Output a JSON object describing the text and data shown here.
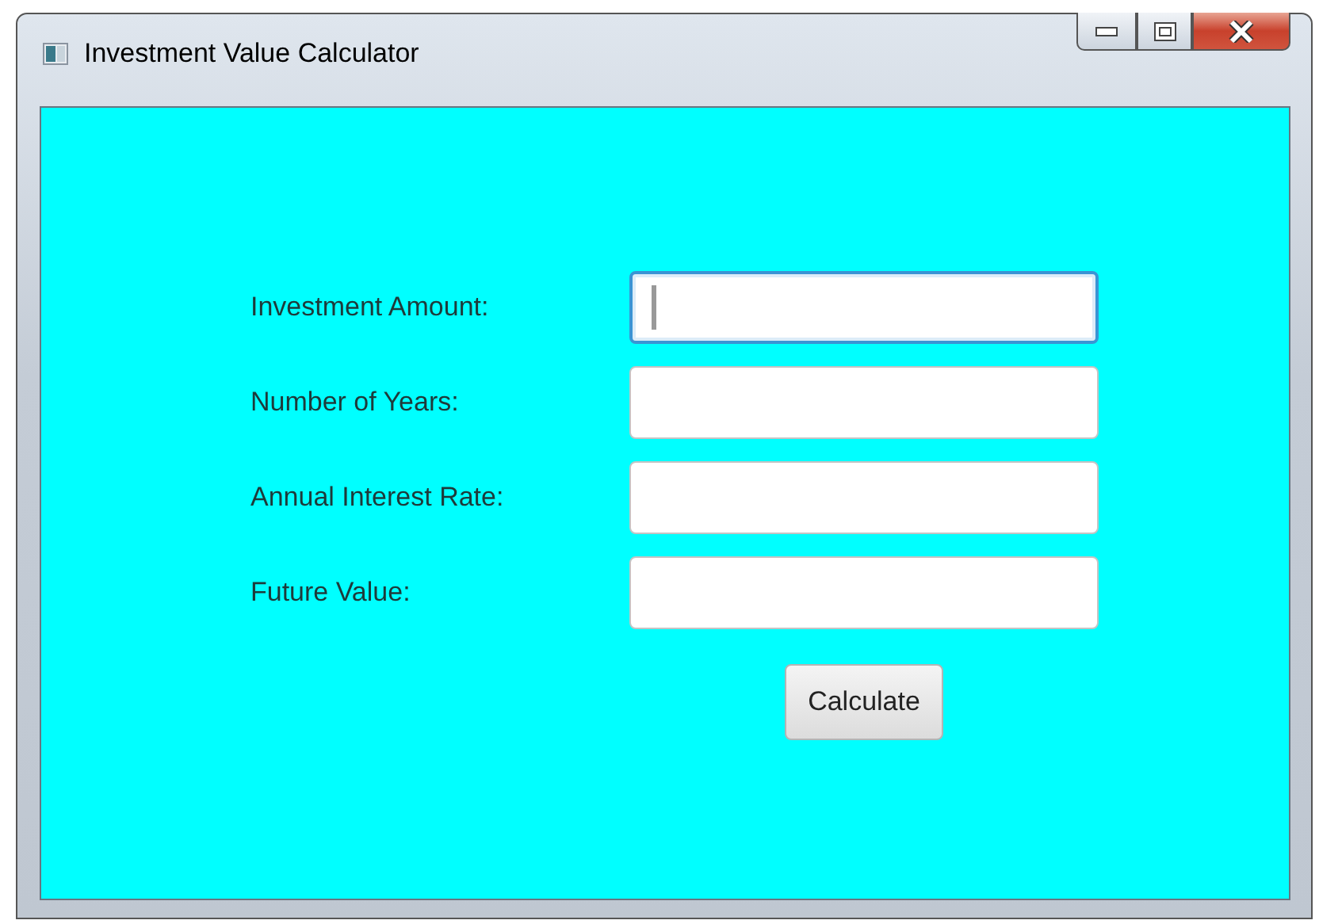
{
  "window": {
    "title": "Investment Value Calculator"
  },
  "fields": [
    {
      "label": "Investment Amount:",
      "focused": true
    },
    {
      "label": "Number of Years:",
      "focused": false
    },
    {
      "label": "Annual Interest Rate:",
      "focused": false
    },
    {
      "label": "Future Value:",
      "focused": false
    }
  ],
  "button": {
    "label": "Calculate"
  }
}
